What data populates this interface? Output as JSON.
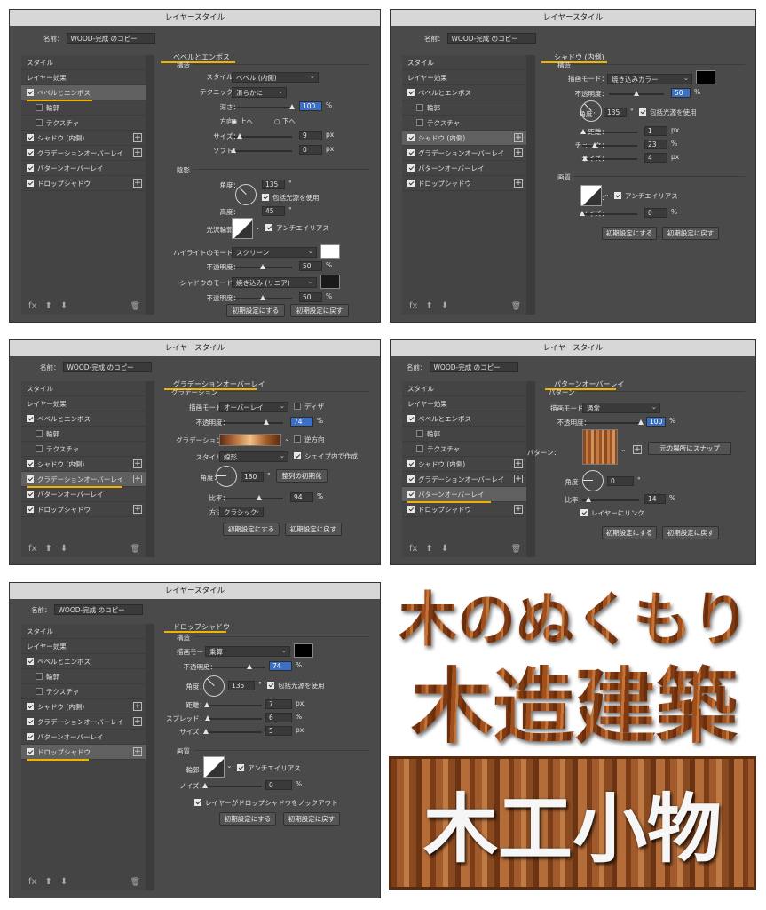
{
  "common": {
    "window_title": "レイヤースタイル",
    "name_label": "名前：",
    "name_value": "WOOD-完成 のコピー",
    "style_header": "スタイル",
    "layer_effects": "レイヤー効果",
    "bevel": "ベベルとエンボス",
    "contour": "輪郭",
    "texture": "テクスチャ",
    "inner_shadow": "シャドウ (内側)",
    "gradient_overlay": "グラデーションオーバーレイ",
    "pattern_overlay": "パターンオーバーレイ",
    "drop_shadow": "ドロップシャドウ",
    "make_default": "初期設定にする",
    "reset_default": "初期設定に戻す",
    "fx": "fx",
    "up_icon": "arrow-up-icon",
    "down_icon": "arrow-down-icon",
    "trash_icon": "trash-icon"
  },
  "bevel_panel": {
    "section": "ベベルとエンボス",
    "structure": "構造",
    "style_label": "スタイル：",
    "style_value": "ベベル (内側)",
    "technique_label": "テクニック：",
    "technique_value": "滑らかに",
    "depth_label": "深さ：",
    "depth_value": "100",
    "depth_unit": "%",
    "direction_label": "方向：",
    "dir_up": "上へ",
    "dir_down": "下へ",
    "size_label": "サイズ：",
    "size_value": "9",
    "size_unit": "px",
    "soften_label": "ソフト：",
    "soften_value": "0",
    "soften_unit": "px",
    "shading": "陰影",
    "angle_label": "角度：",
    "angle_value": "135",
    "deg": "°",
    "global_light": "包括光源を使用",
    "altitude_label": "高度：",
    "altitude_value": "45",
    "gloss_label": "光沢輪郭：",
    "antialias": "アンチエイリアス",
    "highlight_label": "ハイライトのモード：",
    "highlight_value": "スクリーン",
    "highlight_color": "#ffffff",
    "opacity_label": "不透明度：",
    "hl_opacity": "50",
    "shadow_mode_label": "シャドウのモード：",
    "shadow_mode_value": "焼き込み (リニア)",
    "shadow_color": "#1a1a1a",
    "sh_opacity": "50",
    "pct": "%",
    "depth_level": 1.0,
    "size_level": 0.12,
    "soften_level": 0.0,
    "hl_level": 0.5,
    "sh_level": 0.5
  },
  "inner_panel": {
    "section": "シャドウ (内側)",
    "structure": "構造",
    "blend_label": "描画モード：",
    "blend_value": "焼き込みカラー",
    "color": "#000000",
    "opacity_label": "不透明度：",
    "opacity_value": "50",
    "angle_label": "角度：",
    "angle_value": "135",
    "deg": "°",
    "global_light": "包括光源を使用",
    "distance_label": "距離：",
    "distance_value": "1",
    "choke_label": "チョーク：",
    "choke_value": "23",
    "size_label": "サイズ：",
    "size_value": "4",
    "quality": "画質",
    "contour_label": "輪郭：",
    "antialias": "アンチエイリアス",
    "noise_label": "ノイズ：",
    "noise_value": "0",
    "px": "px",
    "pct": "%",
    "opacity_level": 0.5,
    "distance_level": 0.02,
    "choke_level": 0.23,
    "size_level": 0.05,
    "noise_level": 0.0
  },
  "gradient_panel": {
    "section": "グラデーションオーバーレイ",
    "gradient_h": "グラデーション",
    "blend_label": "描画モード：",
    "blend_value": "オーバーレイ",
    "dither": "ディザ",
    "opacity_label": "不透明度：",
    "opacity_value": "74",
    "gradient_label": "グラデーション：",
    "reverse": "逆方向",
    "style_label": "スタイル：",
    "style_value": "線形",
    "align_shape": "シェイプ内で作成",
    "angle_label": "角度：",
    "angle_value": "180",
    "deg": "°",
    "reset_align": "整列の初期化",
    "scale_label": "比率：",
    "scale_value": "94",
    "method_label": "方法：",
    "method_value": "クラシック",
    "pct": "%",
    "opacity_level": 0.74,
    "scale_level": 0.62
  },
  "pattern_panel": {
    "section": "パターンオーバーレイ",
    "pattern_h": "パターン",
    "blend_label": "描画モード：",
    "blend_value": "通常",
    "opacity_label": "不透明度：",
    "opacity_value": "100",
    "pattern_label": "パターン：",
    "snap": "元の場所にスナップ",
    "angle_label": "角度：",
    "angle_value": "0",
    "deg": "°",
    "scale_label": "比率：",
    "scale_value": "14",
    "link": "レイヤーにリンク",
    "pct": "%",
    "opacity_level": 1.0,
    "scale_level": 0.12
  },
  "drop_panel": {
    "section": "ドロップシャドウ",
    "structure": "構造",
    "blend_label": "描画モード：",
    "blend_value": "乗算",
    "color": "#000000",
    "opacity_label": "不透明度：",
    "opacity_value": "74",
    "angle_label": "角度：",
    "angle_value": "135",
    "deg": "°",
    "global_light": "包括光源を使用",
    "distance_label": "距離：",
    "distance_value": "7",
    "spread_label": "スプレッド：",
    "spread_value": "6",
    "size_label": "サイズ：",
    "size_value": "5",
    "quality": "画質",
    "contour_label": "輪郭：",
    "antialias": "アンチエイリアス",
    "noise_label": "ノイズ：",
    "noise_value": "0",
    "knockout": "レイヤーがドロップシャドウをノックアウト",
    "px": "px",
    "pct": "%",
    "opacity_level": 0.74,
    "distance_level": 0.04,
    "spread_level": 0.06,
    "size_level": 0.03,
    "noise_level": 0.0
  },
  "showcase": {
    "line1": "木のぬくもり",
    "line2": "木造建築",
    "line3": "木工小物"
  }
}
